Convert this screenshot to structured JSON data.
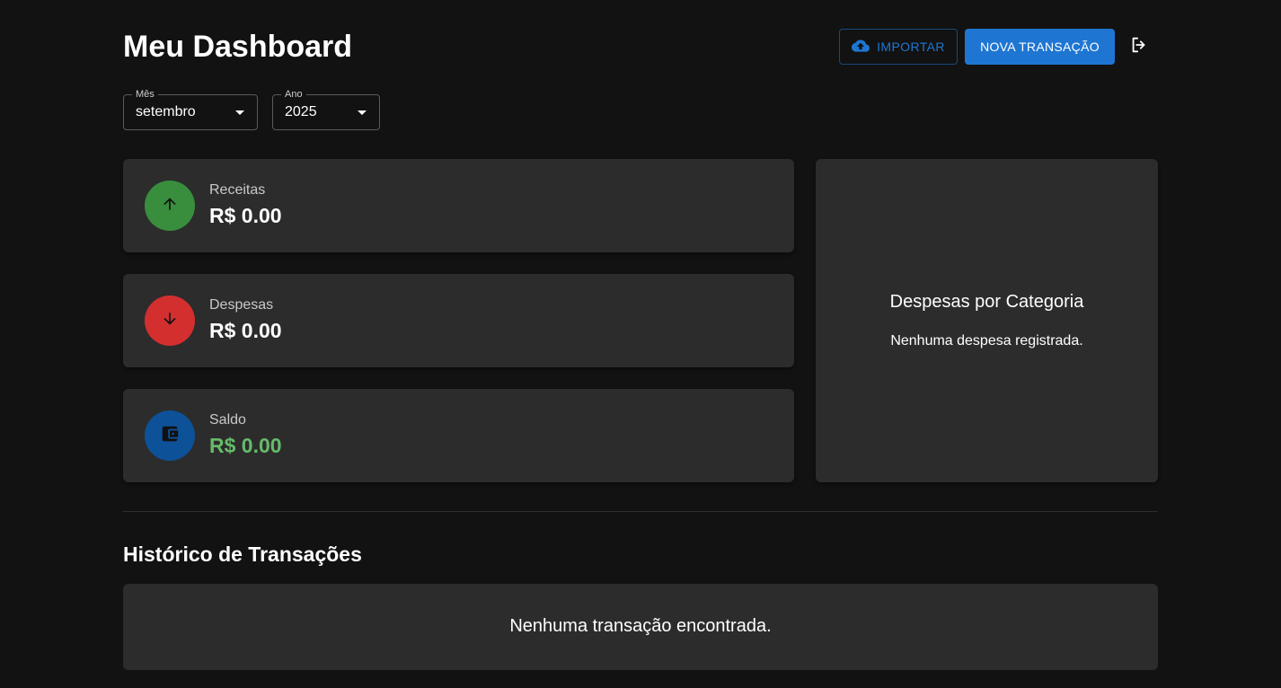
{
  "header": {
    "title": "Meu Dashboard",
    "import_label": "IMPORTAR",
    "new_transaction_label": "NOVA TRANSAÇÃO"
  },
  "filters": {
    "month": {
      "label": "Mês",
      "value": "setembro"
    },
    "year": {
      "label": "Ano",
      "value": "2025"
    }
  },
  "summary": {
    "income": {
      "label": "Receitas",
      "value": "R$ 0.00",
      "color": "#388e3c",
      "icon": "arrow-up-icon"
    },
    "expenses": {
      "label": "Despesas",
      "value": "R$ 0.00",
      "color": "#d32f2f",
      "icon": "arrow-down-icon"
    },
    "balance": {
      "label": "Saldo",
      "value": "R$ 0.00",
      "color": "#0d5199",
      "value_color": "#66bb6a",
      "icon": "wallet-icon"
    }
  },
  "category_chart": {
    "title": "Despesas por Categoria",
    "empty_message": "Nenhuma despesa registrada."
  },
  "history": {
    "title": "Histórico de Transações",
    "empty_message": "Nenhuma transação encontrada."
  },
  "colors": {
    "background": "#121212",
    "card": "#2c2c2c",
    "primary": "#1e76d2"
  }
}
